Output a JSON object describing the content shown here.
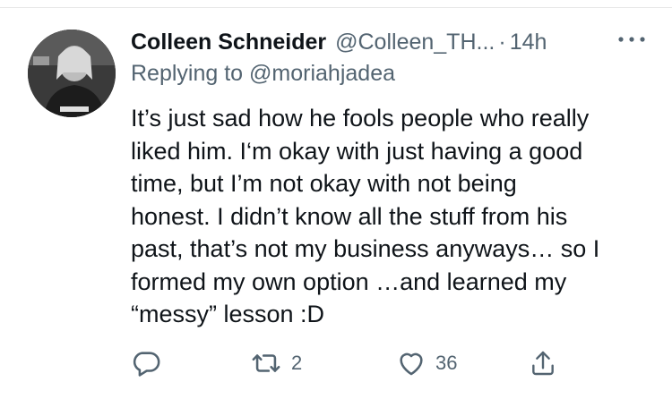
{
  "tweet": {
    "author_name": "Colleen Schneider",
    "handle": "@Colleen_TH...",
    "separator": "·",
    "time": "14h",
    "replying_to_prefix": "Replying to",
    "replying_to_handle": "@moriahjadea",
    "text_lines": [
      "It’s just sad how he fools people who really",
      "liked him. I‘m okay with just having a good",
      "time, but I’m not okay with not being",
      "honest. I didn’t know all the stuff from his",
      "past, that’s not my business anyways… so I",
      "formed my own option …and learned my",
      "“messy” lesson :D"
    ]
  },
  "actions": {
    "reply": {
      "icon": "reply-icon",
      "count": ""
    },
    "retweet": {
      "icon": "retweet-icon",
      "count": "2"
    },
    "like": {
      "icon": "heart-icon",
      "count": "36"
    },
    "share": {
      "icon": "share-icon",
      "count": ""
    }
  },
  "icons": {
    "more": "more-horizontal-icon",
    "avatar": "avatar"
  },
  "colors": {
    "text": "#0f1419",
    "secondary": "#536471",
    "divider": "#e6e6e6"
  }
}
